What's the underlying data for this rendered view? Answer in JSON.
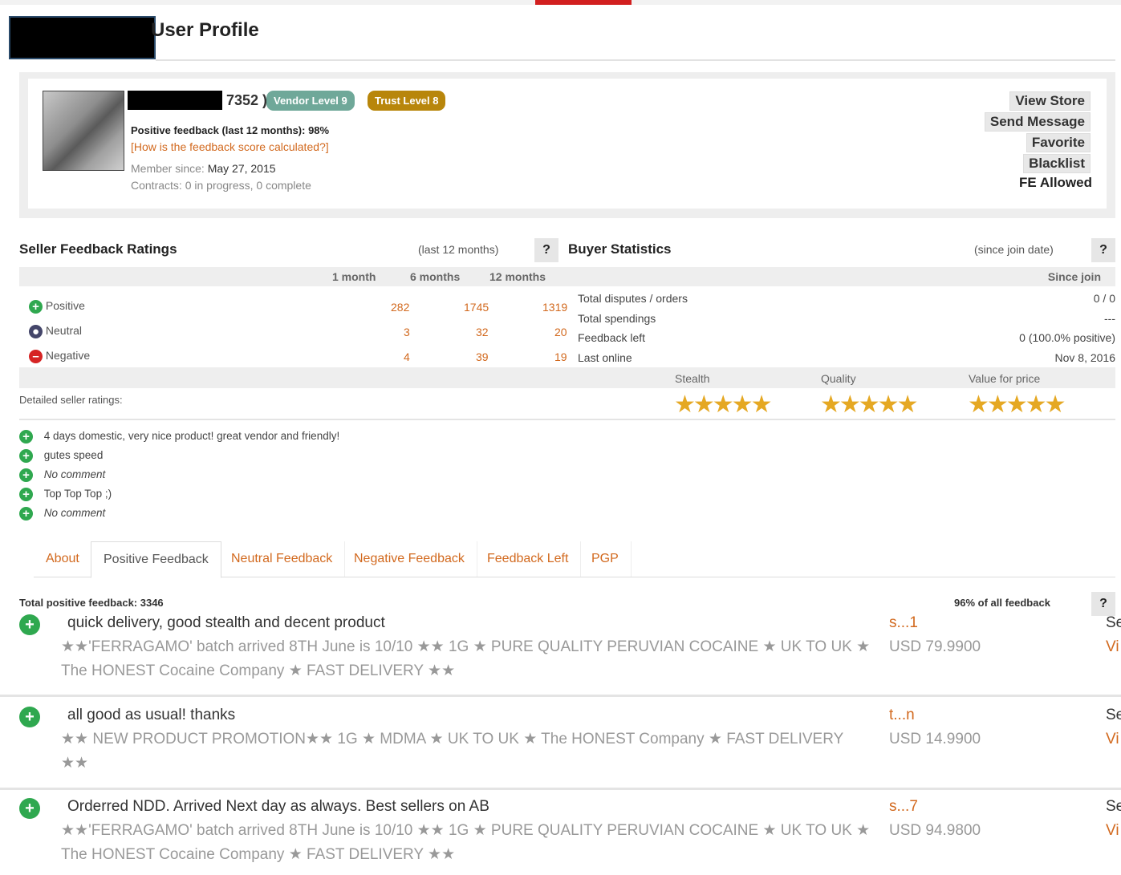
{
  "header": {
    "title": "User Profile"
  },
  "profile": {
    "name_suffix": "7352 )",
    "vendor_level": "Vendor Level 9",
    "trust_level": "Trust Level 8",
    "positive_feedback": "Positive feedback (last 12 months): 98%",
    "feedback_link": "[How is the feedback score calculated?]",
    "member_since_label": "Member since:",
    "member_since_value": "May 27, 2015",
    "contracts": "Contracts: 0 in progress, 0 complete"
  },
  "actions": {
    "view_store": "View Store",
    "send_message": "Send Message",
    "favorite": "Favorite",
    "blacklist": "Blacklist",
    "fe_allowed": "FE Allowed"
  },
  "seller_ratings": {
    "title": "Seller Feedback Ratings",
    "period": "(last 12 months)",
    "help": "?",
    "columns": [
      "1 month",
      "6 months",
      "12 months"
    ],
    "rows": [
      {
        "label": "Positive",
        "values": [
          "282",
          "1745",
          "1319"
        ]
      },
      {
        "label": "Neutral",
        "values": [
          "3",
          "32",
          "20"
        ]
      },
      {
        "label": "Negative",
        "values": [
          "4",
          "39",
          "19"
        ]
      }
    ]
  },
  "buyer_stats": {
    "title": "Buyer Statistics",
    "period": "(since join date)",
    "help": "?",
    "column": "Since join",
    "rows": [
      {
        "label": "Total disputes / orders",
        "value": "0 / 0"
      },
      {
        "label": "Total spendings",
        "value": "---"
      },
      {
        "label": "Feedback left",
        "value": "0 (100.0% positive)"
      },
      {
        "label": "Last online",
        "value": "Nov 8, 2016"
      }
    ]
  },
  "detailed": {
    "label": "Detailed seller ratings:",
    "categories": [
      "Stealth",
      "Quality",
      "Value for price"
    ],
    "stars": "★★★★★",
    "star_ratings": [
      5,
      5,
      5
    ]
  },
  "recent_comments": [
    {
      "text": "4 days domestic, very nice product! great vendor and friendly!",
      "italic": false
    },
    {
      "text": "gutes speed",
      "italic": false
    },
    {
      "text": "No comment",
      "italic": true
    },
    {
      "text": "Top Top Top ;)",
      "italic": false
    },
    {
      "text": "No comment",
      "italic": true
    }
  ],
  "tabs": [
    "About",
    "Positive Feedback",
    "Neutral Feedback",
    "Negative Feedback",
    "Feedback Left",
    "PGP"
  ],
  "feedback_list": {
    "total": "Total positive feedback: 3346",
    "percent": "96% of all feedback",
    "help": "?",
    "items": [
      {
        "comment": "quick delivery, good stealth and decent product",
        "product": "★★'FERRAGAMO' batch arrived 8TH June is 10/10 ★★ 1G ★ PURE QUALITY PERUVIAN COCAINE ★ UK TO UK ★ The HONEST Cocaine Company ★ FAST DELIVERY ★★",
        "user": "s...1",
        "price": "USD 79.9900",
        "see": "Se",
        "view": "Vi"
      },
      {
        "comment": "all good as usual! thanks",
        "product": "★★ NEW PRODUCT PROMOTION★★ 1G ★ MDMA ★ UK TO UK ★ The HONEST Company ★ FAST DELIVERY ★★",
        "user": "t...n",
        "price": "USD 14.9900",
        "see": "Se",
        "view": "Vi"
      },
      {
        "comment": "Orderred NDD. Arrived Next day as always. Best sellers on AB",
        "product": "★★'FERRAGAMO' batch arrived 8TH June is 10/10 ★★ 1G ★ PURE QUALITY PERUVIAN COCAINE ★ UK TO UK ★ The HONEST Cocaine Company ★ FAST DELIVERY ★★",
        "user": "s...7",
        "price": "USD 94.9800",
        "see": "Se",
        "view": "Vi"
      }
    ]
  },
  "colors": {
    "accent": "#d2691e",
    "vendor_badge": "#6fa899",
    "trust_badge": "#b8860b",
    "positive": "#2fa84f",
    "stars": "#e5a823"
  }
}
